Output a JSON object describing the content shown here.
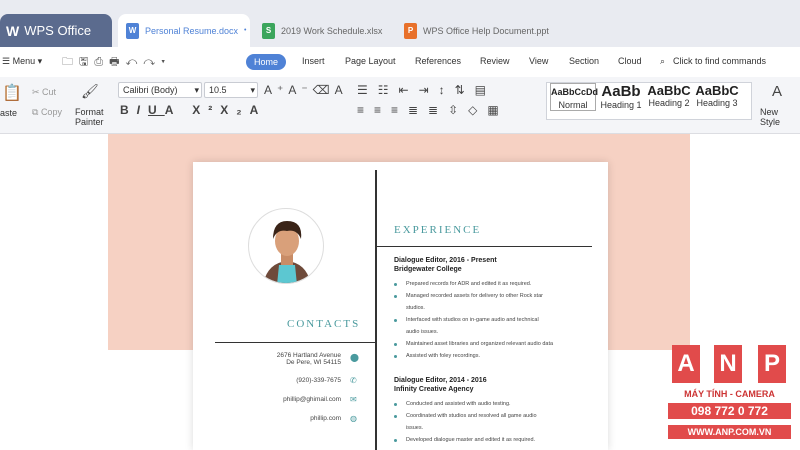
{
  "app": {
    "name": "WPS Office"
  },
  "tabs": [
    {
      "label": "Personal Resume.docx"
    },
    {
      "label": "2019 Work Schedule.xlsx"
    },
    {
      "label": "WPS Office Help Document.ppt"
    }
  ],
  "menu": {
    "menu_label": "Menu",
    "items": [
      "Home",
      "Insert",
      "Page Layout",
      "References",
      "Review",
      "View",
      "Section",
      "Cloud"
    ],
    "find": "Click to find commands"
  },
  "ribbon": {
    "paste": "aste",
    "cut": "Cut",
    "copy": "Copy",
    "format_painter": [
      "Format",
      "Painter"
    ],
    "font": "Calibri (Body)",
    "size": "10.5",
    "styles": [
      {
        "preview": "AaBbCcDd",
        "name": "Normal"
      },
      {
        "preview": "AaBb",
        "name": "Heading 1"
      },
      {
        "preview": "AaBbC",
        "name": "Heading 2"
      },
      {
        "preview": "AaBbC",
        "name": "Heading 3"
      }
    ],
    "new_style": "New Style"
  },
  "resume": {
    "contacts_title": "CONTACTS",
    "address1": "2676 Hartland Avenue",
    "address2": "De Pere, WI 54115",
    "phone": "(920)-339-7675",
    "email": "phillip@ghimail.com",
    "web": "phillip.com",
    "experience_title": "EXPERIENCE",
    "job1_title": "Dialogue Editor, 2016 - Present",
    "job1_company": "Bridgewater College",
    "job1_items": [
      "Prepared records for ADR and edited it as required.",
      "Managed recorded assets for delivery to other Rock star",
      "studios.",
      "Interfaced with studios on in-game audio and technical",
      "audio issues.",
      "Maintained asset libraries and organized relevant audio data",
      "Assisted with foley recordings."
    ],
    "job2_title": "Dialogue Editor, 2014 - 2016",
    "job2_company": "Infinity Creative Agency",
    "job2_items": [
      "Conducted and assisted with audio testing.",
      "Coordinated with studios and resolved all game audio",
      "issues.",
      "Developed dialogue master and edited it as required."
    ]
  },
  "watermark": {
    "letters": [
      "A",
      "N",
      "P"
    ],
    "line1": "MÁY TÍNH - CAMERA",
    "phone": "098 772 0 772",
    "site": "WWW.ANP.COM.VN"
  }
}
